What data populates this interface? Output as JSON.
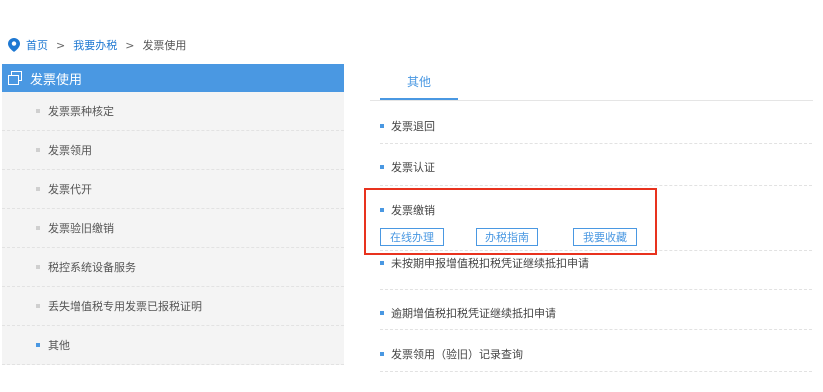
{
  "breadcrumb": {
    "home": "首页",
    "separator": ">",
    "parent": "我要办税",
    "current": "发票使用"
  },
  "sidebar": {
    "title": "发票使用",
    "items": [
      {
        "label": "发票票种核定"
      },
      {
        "label": "发票领用"
      },
      {
        "label": "发票代开"
      },
      {
        "label": "发票验旧缴销"
      },
      {
        "label": "税控系统设备服务"
      },
      {
        "label": "丢失增值税专用发票已报税证明"
      },
      {
        "label": "其他"
      }
    ]
  },
  "main": {
    "tab": "其他",
    "items": [
      {
        "label": "发票退回"
      },
      {
        "label": "发票认证"
      },
      {
        "label": "发票缴销",
        "actions": [
          "在线办理",
          "办税指南",
          "我要收藏"
        ]
      },
      {
        "label": "未按期申报增值税扣税凭证继续抵扣申请"
      },
      {
        "label": "逾期增值税扣税凭证继续抵扣申请"
      },
      {
        "label": "发票领用（验旧）记录查询"
      }
    ]
  },
  "icons": {
    "breadcrumb": "location-pin-icon",
    "sidebar_header": "window-icon"
  },
  "colors": {
    "accent": "#4a98e2",
    "link": "#1e78d2",
    "highlight": "#e8321e"
  }
}
